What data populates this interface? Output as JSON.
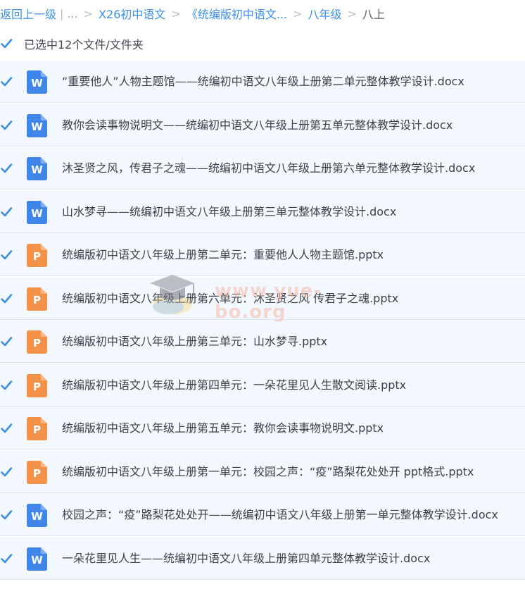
{
  "breadcrumb": {
    "back_label": "返回上一级",
    "ellipsis": "...",
    "items": [
      "X26初中语文",
      "《统编版初中语文...",
      "八年级",
      "八上"
    ]
  },
  "select_all": {
    "label": "已选中12个文件/文件夹",
    "checked": true
  },
  "accent_color": "#3b8fe8",
  "files": [
    {
      "name": "“重要他人”人物主题馆——统编初中语文八年级上册第二单元整体教学设计.docx",
      "type": "word",
      "icon_letter": "W",
      "icon_color": "#3f86e8",
      "checked": true
    },
    {
      "name": "教你会读事物说明文——统编初中语文八年级上册第五单元整体教学设计.docx",
      "type": "word",
      "icon_letter": "W",
      "icon_color": "#3f86e8",
      "checked": true
    },
    {
      "name": "沐圣贤之风，传君子之魂——统编初中语文八年级上册第六单元整体教学设计.docx",
      "type": "word",
      "icon_letter": "W",
      "icon_color": "#3f86e8",
      "checked": true
    },
    {
      "name": "山水梦寻——统编初中语文八年级上册第三单元整体教学设计.docx",
      "type": "word",
      "icon_letter": "W",
      "icon_color": "#3f86e8",
      "checked": true
    },
    {
      "name": "统编版初中语文八年级上册第二单元：重要他人人物主题馆.pptx",
      "type": "powerpoint",
      "icon_letter": "P",
      "icon_color": "#f5924a",
      "checked": true
    },
    {
      "name": "统编版初中语文八年级上册第六单元：沐圣贤之风 传君子之魂.pptx",
      "type": "powerpoint",
      "icon_letter": "P",
      "icon_color": "#f5924a",
      "checked": true
    },
    {
      "name": "统编版初中语文八年级上册第三单元：山水梦寻.pptx",
      "type": "powerpoint",
      "icon_letter": "P",
      "icon_color": "#f5924a",
      "checked": true
    },
    {
      "name": "统编版初中语文八年级上册第四单元：一朵花里见人生散文阅读.pptx",
      "type": "powerpoint",
      "icon_letter": "P",
      "icon_color": "#f5924a",
      "checked": true
    },
    {
      "name": "统编版初中语文八年级上册第五单元：教你会读事物说明文.pptx",
      "type": "powerpoint",
      "icon_letter": "P",
      "icon_color": "#f5924a",
      "checked": true
    },
    {
      "name": "统编版初中语文八年级上册第一单元：校园之声：“疫”路梨花处处开 ppt格式.pptx",
      "type": "powerpoint",
      "icon_letter": "P",
      "icon_color": "#f5924a",
      "checked": true
    },
    {
      "name": "校园之声：“疫”路梨花处处开——统编初中语文八年级上册第一单元整体教学设计.docx",
      "type": "word",
      "icon_letter": "W",
      "icon_color": "#3f86e8",
      "checked": true
    },
    {
      "name": "一朵花里见人生——统编初中语文八年级上册第四单元整体教学设计.docx",
      "type": "word",
      "icon_letter": "W",
      "icon_color": "#3f86e8",
      "checked": true
    }
  ],
  "watermark": {
    "text": "www.yue-bo.org",
    "icon": "graduation-cap-icon"
  }
}
